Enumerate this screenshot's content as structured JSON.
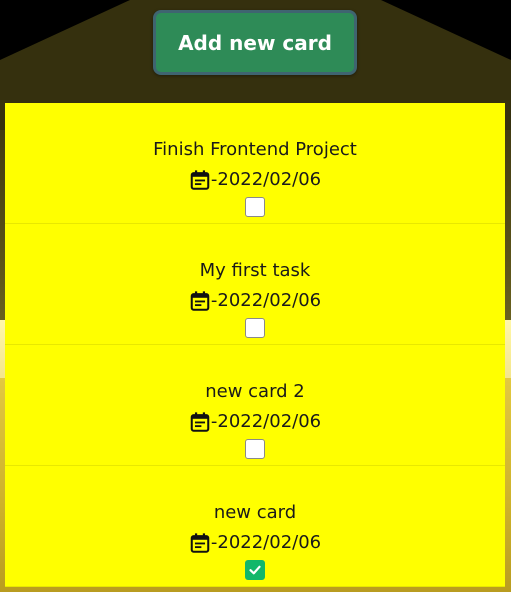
{
  "toolbar": {
    "add_button_label": "Add new card"
  },
  "cards": [
    {
      "title": "Finish Frontend Project",
      "date": "-2022/02/06",
      "checked": false
    },
    {
      "title": "My first task",
      "date": "-2022/02/06",
      "checked": false
    },
    {
      "title": "new card 2",
      "date": "-2022/02/06",
      "checked": false
    },
    {
      "title": "new card",
      "date": "-2022/02/06",
      "checked": true
    }
  ],
  "icons": {
    "date": "calendar-icon",
    "checkbox_checked": "check-icon"
  },
  "colors": {
    "card_background": "#ffff00",
    "add_button": "#2e8b57",
    "checkbox_checked": "#12b76a"
  }
}
